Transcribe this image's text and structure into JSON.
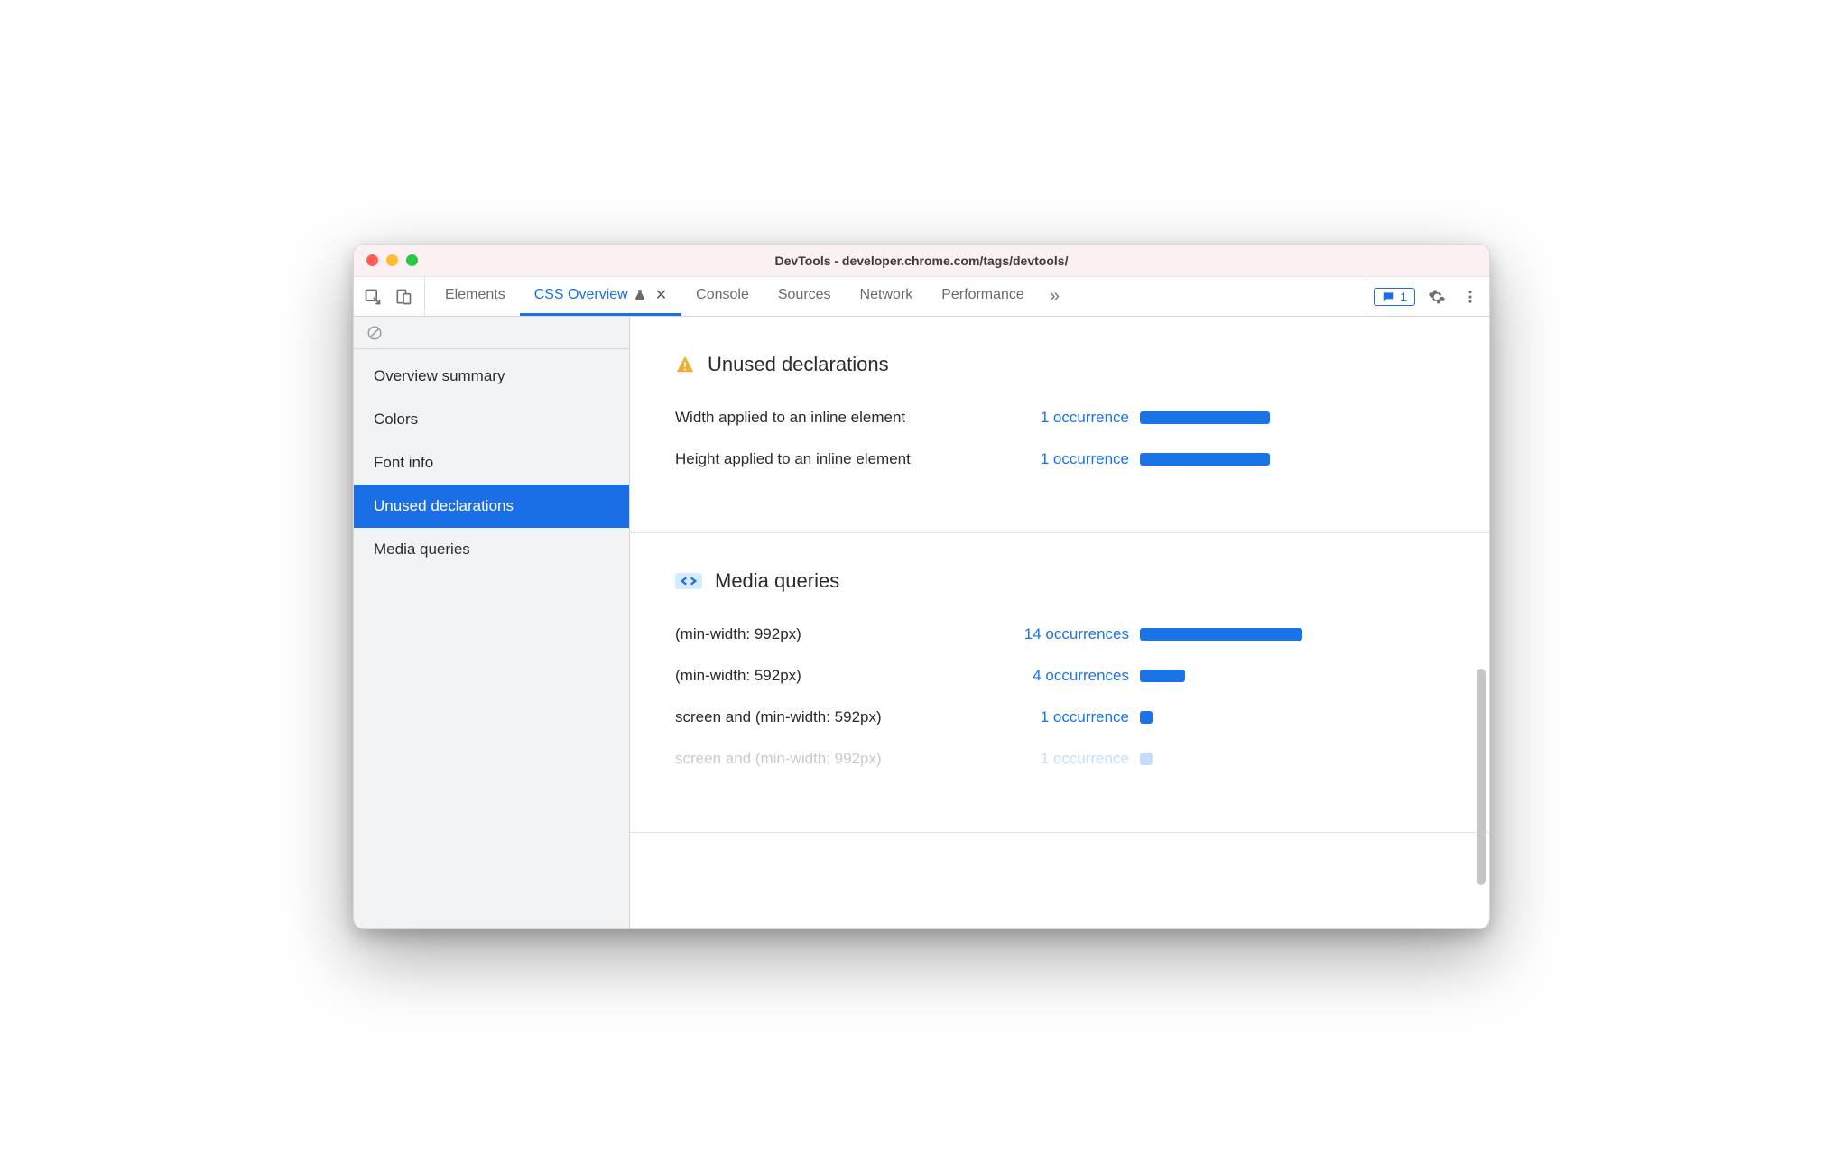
{
  "window": {
    "title": "DevTools - developer.chrome.com/tags/devtools/"
  },
  "tabs": {
    "items": [
      {
        "label": "Elements"
      },
      {
        "label": "CSS Overview"
      },
      {
        "label": "Console"
      },
      {
        "label": "Sources"
      },
      {
        "label": "Network"
      },
      {
        "label": "Performance"
      }
    ],
    "active_index": 1
  },
  "messages_badge": "1",
  "sidebar": {
    "items": [
      {
        "label": "Overview summary"
      },
      {
        "label": "Colors"
      },
      {
        "label": "Font info"
      },
      {
        "label": "Unused declarations"
      },
      {
        "label": "Media queries"
      }
    ],
    "selected_index": 3
  },
  "sections": {
    "unused": {
      "title": "Unused declarations",
      "rows": [
        {
          "label": "Width applied to an inline element",
          "count": "1 occurrence",
          "bar_pct": 80
        },
        {
          "label": "Height applied to an inline element",
          "count": "1 occurrence",
          "bar_pct": 80
        }
      ]
    },
    "media": {
      "title": "Media queries",
      "rows": [
        {
          "label": "(min-width: 992px)",
          "count": "14 occurrences",
          "bar_pct": 100
        },
        {
          "label": "(min-width: 592px)",
          "count": "4 occurrences",
          "bar_pct": 28
        },
        {
          "label": "screen and (min-width: 592px)",
          "count": "1 occurrence",
          "bar_pct": 8
        },
        {
          "label": "screen and (min-width: 992px)",
          "count": "1 occurrence",
          "bar_pct": 8
        }
      ]
    }
  }
}
